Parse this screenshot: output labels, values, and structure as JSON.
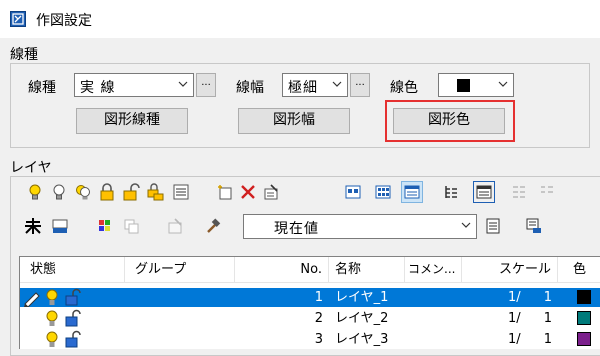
{
  "window": {
    "title": "作図設定"
  },
  "line_group": {
    "title": "線種",
    "line_type_label": "線種",
    "line_type_value": "実 線",
    "line_width_label": "線幅",
    "line_width_value": "極細",
    "line_color_label": "線色",
    "line_color_value": "#000000",
    "dots_label": "...",
    "buttons": {
      "shape_line_type": "図形線種",
      "shape_width": "図形幅",
      "shape_color": "図形色"
    }
  },
  "layer_group": {
    "title": "レイヤ",
    "current_value": "現在値"
  },
  "table": {
    "headers": {
      "status": "状態",
      "group": "グループ",
      "no": "No.",
      "name": "名称",
      "comment": "コメン...",
      "scale": "スケール",
      "color": "色"
    },
    "rows": [
      {
        "no": "1",
        "name": "レイヤ_1",
        "scale_a": "1/",
        "scale_b": "1",
        "color": "#000000",
        "selected": true
      },
      {
        "no": "2",
        "name": "レイヤ_2",
        "scale_a": "1/",
        "scale_b": "1",
        "color": "#007b7b",
        "selected": false
      },
      {
        "no": "3",
        "name": "レイヤ_3",
        "scale_a": "1/",
        "scale_b": "1",
        "color": "#7b1f8c",
        "selected": false
      }
    ]
  },
  "colors": {
    "highlight": "#e53030",
    "selection": "#0078d7"
  }
}
